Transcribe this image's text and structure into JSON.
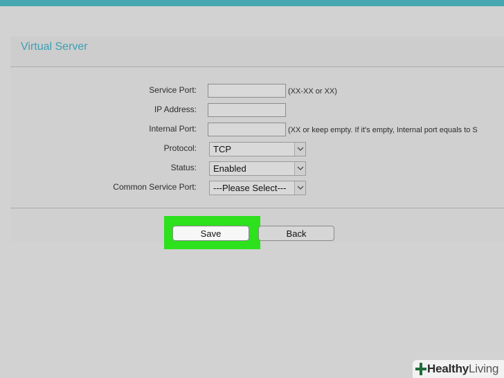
{
  "header": {
    "title": "Virtual Server"
  },
  "form": {
    "service_port": {
      "label": "Service Port:",
      "value": "",
      "hint": "(XX-XX or XX)"
    },
    "ip_address": {
      "label": "IP Address:",
      "value": ""
    },
    "internal_port": {
      "label": "Internal Port:",
      "value": "",
      "hint": "(XX or keep empty. If it's empty, Internal port equals to S"
    },
    "protocol": {
      "label": "Protocol:",
      "selected": "TCP"
    },
    "status": {
      "label": "Status:",
      "selected": "Enabled"
    },
    "common_service_port": {
      "label": "Common Service Port:",
      "selected": "---Please Select---"
    }
  },
  "buttons": {
    "save": "Save",
    "back": "Back"
  },
  "colors": {
    "accent": "#46a7b0",
    "highlight": "#2de11d"
  },
  "watermark": {
    "brand": "Healthy",
    "brand2": "Living"
  }
}
